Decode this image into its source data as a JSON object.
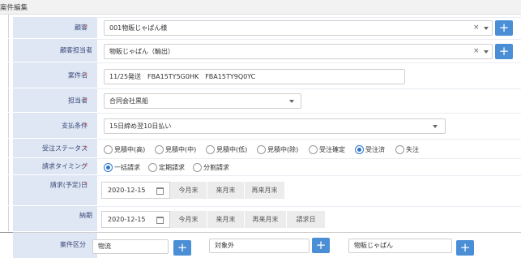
{
  "window": {
    "title": "案件編集"
  },
  "fields": {
    "customer": {
      "label": "顧客",
      "value": "001物販じゃぱん様"
    },
    "customer_contact": {
      "label": "顧客担当者",
      "value": "物販じゃぱん（輸出）"
    },
    "case_name": {
      "label": "案件名",
      "value": "11/25発送　FBA15TY5G0HK　FBA15TY9Q0YC"
    },
    "assignee": {
      "label": "担当者",
      "value": "合同会社黒船"
    },
    "payment_terms": {
      "label": "支払条件",
      "value": "15日締め翌10日払い"
    },
    "order_status": {
      "label": "受注ステータス",
      "options": [
        "見積中(高)",
        "見積中(中)",
        "見積中(低)",
        "見積中(除)",
        "受注確定",
        "受注済",
        "失注"
      ],
      "selected": "受注済"
    },
    "billing_timing": {
      "label": "請求タイミング",
      "options": [
        "一括請求",
        "定期請求",
        "分割請求"
      ],
      "selected": "一括請求"
    },
    "billing_date": {
      "label": "請求(予定)日",
      "value": "2020-12-15",
      "quick": [
        "今月末",
        "来月末",
        "再来月末"
      ]
    },
    "due_date": {
      "label": "納期",
      "value": "2020-12-15",
      "quick": [
        "今月末",
        "来月末",
        "再来月末",
        "請求日"
      ]
    },
    "case_category": {
      "label": "案件区分",
      "values": [
        "物流",
        "対象外",
        "物販じゃぱん"
      ]
    }
  },
  "required_mark": "*",
  "icons": {
    "clear": "close-icon",
    "dropdown": "chevron-down-icon",
    "add": "plus-icon",
    "calendar": "calendar-icon"
  },
  "colors": {
    "label_bg": "#dfe7f4",
    "label_text": "#3a4a78",
    "required": "#d9534f",
    "add_button": "#4a8fd6",
    "radio_selected": "#2f76c8",
    "quick_button_bg": "#ececec"
  }
}
